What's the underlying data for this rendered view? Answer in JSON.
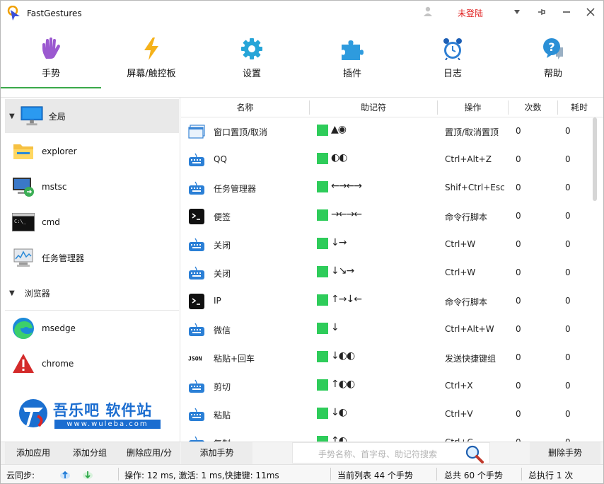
{
  "window": {
    "title": "FastGestures",
    "login_label": "未登陆",
    "buttons": [
      "▾",
      "pin",
      "minimize",
      "close"
    ]
  },
  "nav": {
    "tabs": [
      {
        "label": "手势",
        "icon": "hand-icon",
        "active": true
      },
      {
        "label": "屏幕/触控板",
        "icon": "lightning-icon",
        "active": false
      },
      {
        "label": "设置",
        "icon": "gear-icon",
        "active": false
      },
      {
        "label": "插件",
        "icon": "puzzle-icon",
        "active": false
      },
      {
        "label": "日志",
        "icon": "alarm-clock-icon",
        "active": false
      },
      {
        "label": "帮助",
        "icon": "help-icon",
        "active": false
      }
    ],
    "accent": "#3aa94a"
  },
  "sidebar": {
    "global_label": "全局",
    "apps": [
      {
        "label": "explorer",
        "icon": "folder-icon"
      },
      {
        "label": "mstsc",
        "icon": "remote-desktop-icon"
      },
      {
        "label": "cmd",
        "icon": "terminal-icon"
      },
      {
        "label": "任务管理器",
        "icon": "task-manager-icon"
      }
    ],
    "group_label": "浏览器",
    "browser_apps": [
      {
        "label": "msedge",
        "icon": "edge-icon"
      },
      {
        "label": "chrome",
        "icon": "warning-icon"
      }
    ],
    "watermark": {
      "title": "吾乐吧 软件站",
      "url": "www.wuleba.com"
    }
  },
  "table": {
    "headers": {
      "name": "名称",
      "mnemonic": "助记符",
      "action": "操作",
      "count": "次数",
      "time": "耗时"
    },
    "rows": [
      {
        "icon": "window-icon",
        "name": "窗口置顶/取消",
        "mnemonic": "▲◉",
        "action": "置顶/取消置顶",
        "count": "0",
        "time": "0"
      },
      {
        "icon": "keyboard-icon",
        "name": "QQ",
        "mnemonic": "◐◐",
        "action": "Ctrl+Alt+Z",
        "count": "0",
        "time": "0"
      },
      {
        "icon": "keyboard-icon",
        "name": "任务管理器",
        "mnemonic": "←→←→",
        "action": "Shif+Ctrl+Esc",
        "count": "0",
        "time": "0"
      },
      {
        "icon": "terminal-icon",
        "name": "便签",
        "mnemonic": "→←→←",
        "action": "命令行脚本",
        "count": "0",
        "time": "0"
      },
      {
        "icon": "keyboard-icon",
        "name": "关闭",
        "mnemonic": "↓→",
        "action": "Ctrl+W",
        "count": "0",
        "time": "0"
      },
      {
        "icon": "keyboard-icon",
        "name": "关闭",
        "mnemonic": "↓↘→",
        "action": "Ctrl+W",
        "count": "0",
        "time": "0"
      },
      {
        "icon": "terminal-icon",
        "name": "IP",
        "mnemonic": "↑→↓←",
        "action": "命令行脚本",
        "count": "0",
        "time": "0"
      },
      {
        "icon": "keyboard-icon",
        "name": "微信",
        "mnemonic": "↓",
        "action": "Ctrl+Alt+W",
        "count": "0",
        "time": "0"
      },
      {
        "icon": "json-icon",
        "name": "粘贴+回车",
        "mnemonic": "↓◐◐",
        "action": "发送快捷键组",
        "count": "0",
        "time": "0"
      },
      {
        "icon": "keyboard-icon",
        "name": "剪切",
        "mnemonic": "↑◐◐",
        "action": "Ctrl+X",
        "count": "0",
        "time": "0"
      },
      {
        "icon": "keyboard-icon",
        "name": "粘贴",
        "mnemonic": "↓◐",
        "action": "Ctrl+V",
        "count": "0",
        "time": "0"
      },
      {
        "icon": "keyboard-icon",
        "name": "复制",
        "mnemonic": "↑◐",
        "action": "Ctrl+C",
        "count": "0",
        "time": "0"
      }
    ]
  },
  "toolbar": {
    "add_app": "添加应用",
    "add_group": "添加分组",
    "delete_app": "删除应用/分",
    "add_gesture": "添加手势",
    "search_placeholder": "手势名称、首字母、助记符搜索",
    "delete_gesture": "删除手势"
  },
  "status": {
    "cloud_sync": "云同步:",
    "perf": "操作: 12 ms, 激活: 1 ms,快捷键: 11ms",
    "current_list": "当前列表 44 个手势",
    "total": "总共 60 个手势",
    "executed": "总执行 1 次"
  }
}
